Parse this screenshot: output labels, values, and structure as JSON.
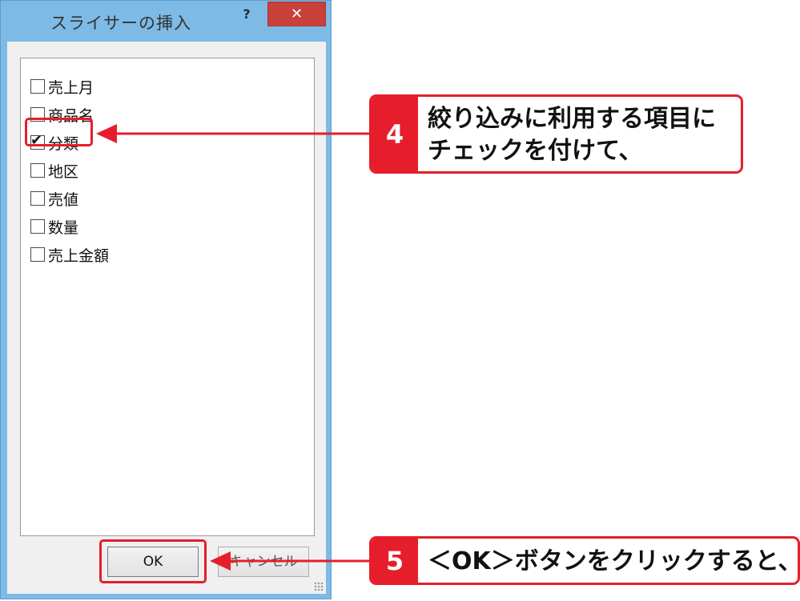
{
  "dialog": {
    "title": "スライサーの挿入",
    "help_label": "?",
    "close_label": "✕",
    "fields": [
      {
        "label": "売上月",
        "checked": false
      },
      {
        "label": "商品名",
        "checked": false
      },
      {
        "label": "分類",
        "checked": true
      },
      {
        "label": "地区",
        "checked": false
      },
      {
        "label": "売値",
        "checked": false
      },
      {
        "label": "数量",
        "checked": false
      },
      {
        "label": "売上金額",
        "checked": false
      }
    ],
    "check_glyph": "✔",
    "ok_label": "OK",
    "cancel_label": "キャンセル"
  },
  "callouts": {
    "step4": {
      "number": "4",
      "line1": "絞り込みに利用する項目に",
      "line2": "チェックを付けて、"
    },
    "step5": {
      "number": "5",
      "text": "＜OK＞ボタンをクリックすると、"
    }
  },
  "colors": {
    "accent_red": "#e61e2b",
    "window_frame": "#7dbbe6",
    "close_button": "#c8403a"
  }
}
